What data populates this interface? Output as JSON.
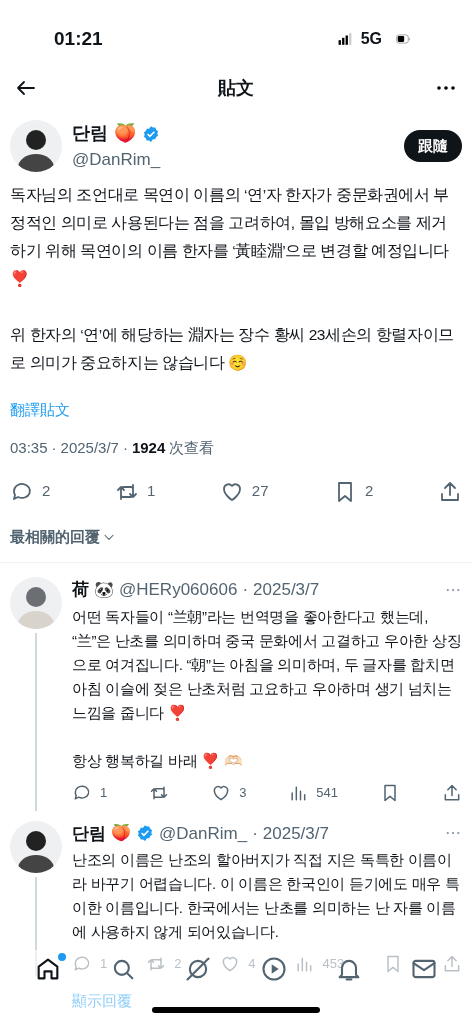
{
  "status_bar": {
    "time": "01:21",
    "network": "5G"
  },
  "header": {
    "title": "貼文"
  },
  "post": {
    "author": {
      "name": "단림",
      "emoji": "🍑",
      "verified": true,
      "handle": "@DanRim_"
    },
    "follow_button": "跟隨",
    "paragraphs": [
      "독자님의 조언대로 목연이 이름의 ‘연’자 한자가 중문화권에서 부정적인 의미로 사용된다는 점을 고려하여, 몰입 방해요소를 제거하기 위해 목연이의 이름 한자를 ‘黃睦淵’으로 변경할 예정입니다 ❣️",
      "위 한자의 ‘연’에 해당하는 淵자는 장수 황씨 23세손의 항렬자이므로 의미가 중요하지는 않습니다 ☺️"
    ],
    "translate_link": "翻譯貼文",
    "meta": {
      "separator": "·",
      "time": "03:35",
      "date": "2025/3/7",
      "views": "1924",
      "views_label": "次查看"
    },
    "actions": [
      {
        "kind": "reply",
        "count": "2"
      },
      {
        "kind": "repost",
        "count": "1"
      },
      {
        "kind": "like",
        "count": "27"
      },
      {
        "kind": "bookmark",
        "count": "2"
      },
      {
        "kind": "share"
      }
    ]
  },
  "sort": {
    "label": "最相關的回覆"
  },
  "replies": [
    {
      "name": "荷",
      "emoji": "🐼",
      "verified": false,
      "handle": "@HERy060606",
      "separator": "·",
      "date": "2025/3/7",
      "paragraphs": [
        "어떤 독자들이 “兰朝”라는 번역명을 좋아한다고 했는데, “兰”은 난초를 의미하며 중국 문화에서 고결하고 우아한 상징으로 여겨집니다. “朝”는 아침을 의미하며, 두 글자를 합치면 아침 이슬에 젖은 난초처럼 고요하고 우아하며 생기 넘치는 느낌을 줍니다 ❣️",
        "항상 행복하길 바래 ❣️ 🫶🏻"
      ],
      "actions": [
        {
          "kind": "reply",
          "count": "1"
        },
        {
          "kind": "repost"
        },
        {
          "kind": "like",
          "count": "3"
        },
        {
          "kind": "views",
          "count": "541"
        },
        {
          "kind": "bookmark"
        },
        {
          "kind": "share"
        }
      ]
    },
    {
      "name": "단림",
      "emoji": "🍑",
      "verified": true,
      "handle": "@DanRim_",
      "separator": "·",
      "date": "2025/3/7",
      "paragraphs": [
        "난조의 이름은 난조의 할아버지가 직접 지은 독특한 이름이라 바꾸기 어렵습니다. 이 이름은 한국인이 듣기에도 매우 특이한 이름입니다. 한국에서는 난초를 의미하는 난 자를 이름에 사용하지 않게 되어있습니다."
      ],
      "actions": [
        {
          "kind": "reply",
          "count": "1"
        },
        {
          "kind": "repost",
          "count": "2"
        },
        {
          "kind": "like",
          "count": "4"
        },
        {
          "kind": "views",
          "count": "453"
        },
        {
          "kind": "bookmark"
        },
        {
          "kind": "share"
        }
      ]
    }
  ],
  "show_replies": "顯示回覆",
  "tab_bar": [
    {
      "kind": "home",
      "selected": true,
      "badge": true
    },
    {
      "kind": "search",
      "selected": false
    },
    {
      "kind": "grok",
      "selected": false
    },
    {
      "kind": "video",
      "selected": false
    },
    {
      "kind": "notifications",
      "selected": false
    },
    {
      "kind": "messages",
      "selected": false
    }
  ]
}
